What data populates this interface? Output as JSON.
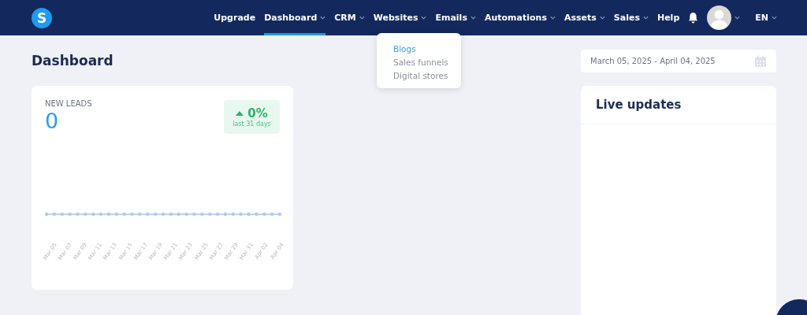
{
  "nav": {
    "logo": "S",
    "items": [
      {
        "label": "Upgrade",
        "kind": "link",
        "selected": false
      },
      {
        "label": "Dashboard",
        "kind": "dropdown",
        "selected": true
      },
      {
        "label": "CRM",
        "kind": "dropdown",
        "selected": false
      },
      {
        "label": "Websites",
        "kind": "dropdown",
        "selected": false
      },
      {
        "label": "Emails",
        "kind": "dropdown",
        "selected": false
      },
      {
        "label": "Automations",
        "kind": "dropdown",
        "selected": false
      },
      {
        "label": "Assets",
        "kind": "dropdown",
        "selected": false
      },
      {
        "label": "Sales",
        "kind": "dropdown",
        "selected": false
      },
      {
        "label": "Help",
        "kind": "link",
        "selected": false
      }
    ],
    "language": "EN"
  },
  "dropdown": {
    "items": [
      {
        "label": "Blogs",
        "selected": true
      },
      {
        "label": "Sales funnels",
        "selected": false
      },
      {
        "label": "Digital stores",
        "selected": false
      }
    ]
  },
  "page_title": "Dashboard",
  "date_range": {
    "value": "March 05, 2025 - April 04, 2025"
  },
  "new_leads": {
    "title": "NEW LEADS",
    "value": "0",
    "change": "0%",
    "period": "last 31 days",
    "x_labels": [
      "Mar 05",
      "Mar 07",
      "Mar 09",
      "Mar 11",
      "Mar 13",
      "Mar 15",
      "Mar 17",
      "Mar 19",
      "Mar 21",
      "Mar 23",
      "Mar 25",
      "Mar 27",
      "Mar 29",
      "Mar 31",
      "Apr 02",
      "Apr 04"
    ]
  },
  "live_updates": {
    "title": "Live updates"
  }
}
